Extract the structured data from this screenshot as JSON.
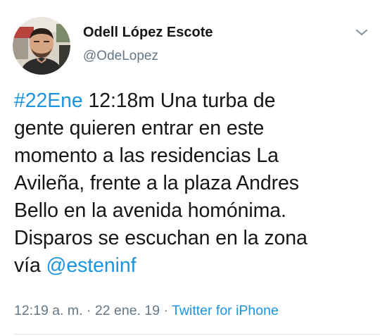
{
  "author": {
    "display_name": "Odell López Escote",
    "handle": "@OdeLopez"
  },
  "icons": {
    "menu": "chevron-down-icon",
    "avatar": "profile-photo"
  },
  "tweet": {
    "hashtag": "#22Ene",
    "line1_rest": " 12:18m Una turba de",
    "line2": "gente quieren entrar en este",
    "line3": "momento a las residencias La",
    "line4": "Avileña, frente a la plaza Andres",
    "line5": "Bello en la avenida homónima.",
    "line6": "Disparos se escuchan en la zona",
    "line7_prefix": "vía ",
    "mention": "@esteninf"
  },
  "meta": {
    "time": "12:19 a. m.",
    "sep1": " · ",
    "date": "22 ene. 19",
    "sep2": " · ",
    "source": "Twitter for iPhone"
  },
  "colors": {
    "link": "#1b95e0",
    "secondary_text": "#657786",
    "primary_text": "#14171a"
  }
}
